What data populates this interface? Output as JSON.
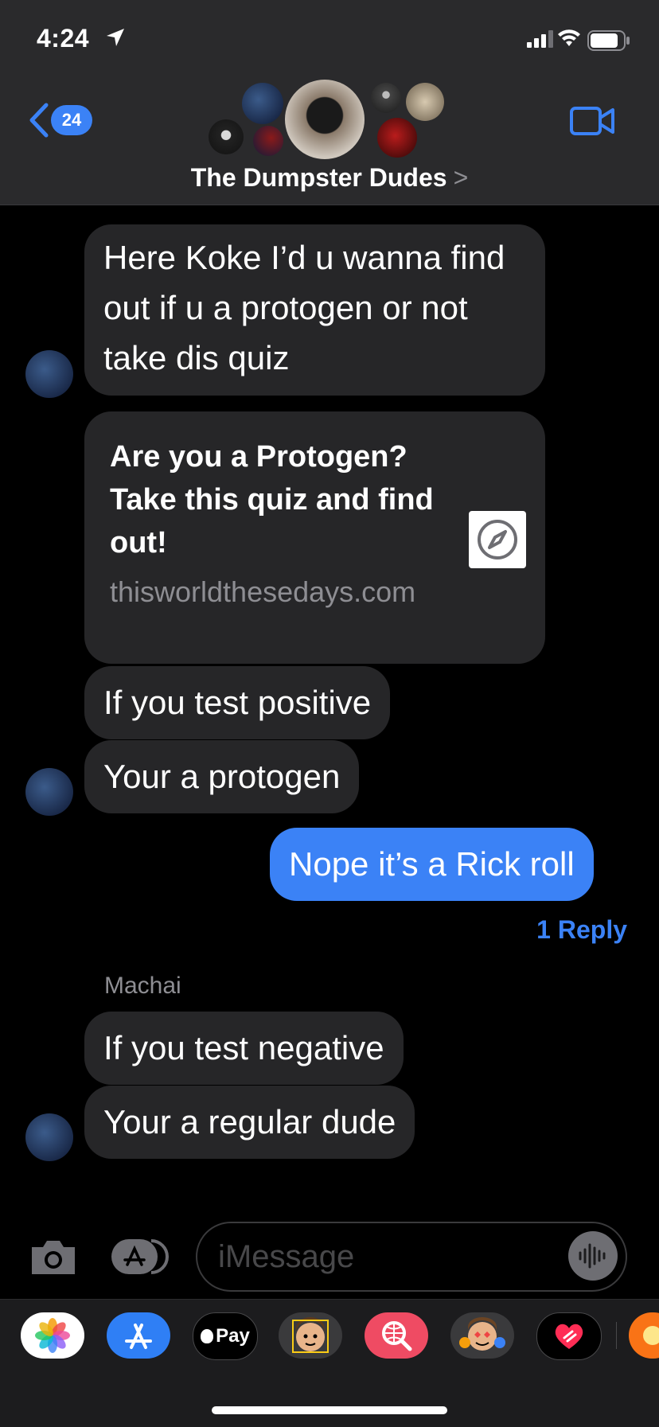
{
  "status_bar": {
    "time": "4:24"
  },
  "header": {
    "back_badge_count": "24",
    "group_name": "The Dumpster Dudes",
    "chevron": ">"
  },
  "messages": {
    "msg1": "Here Koke I’d u wanna find out if u a protogen or not take dis quiz",
    "link_title": "Are you a Protogen? Take this quiz and find out!",
    "link_url": "thisworldthesedays.com",
    "msg2": "If you test positive",
    "msg3": "Your a protogen",
    "sent1": "Nope it’s a Rick roll",
    "reply_link": "1 Reply",
    "sender_name": "Machai",
    "msg4": "If you test negative",
    "msg5": "Your a regular dude"
  },
  "input": {
    "placeholder": "iMessage"
  },
  "app_drawer": {
    "items": [
      "Photos",
      "App Store",
      "Apple Pay",
      "Memoji",
      "Search",
      "Memoji Stickers",
      "Digital Touch"
    ],
    "apple_pay_label": "Pay"
  },
  "colors": {
    "accent": "#3b82f6",
    "received_bubble": "#262628",
    "header_bg": "#2a2a2c"
  }
}
